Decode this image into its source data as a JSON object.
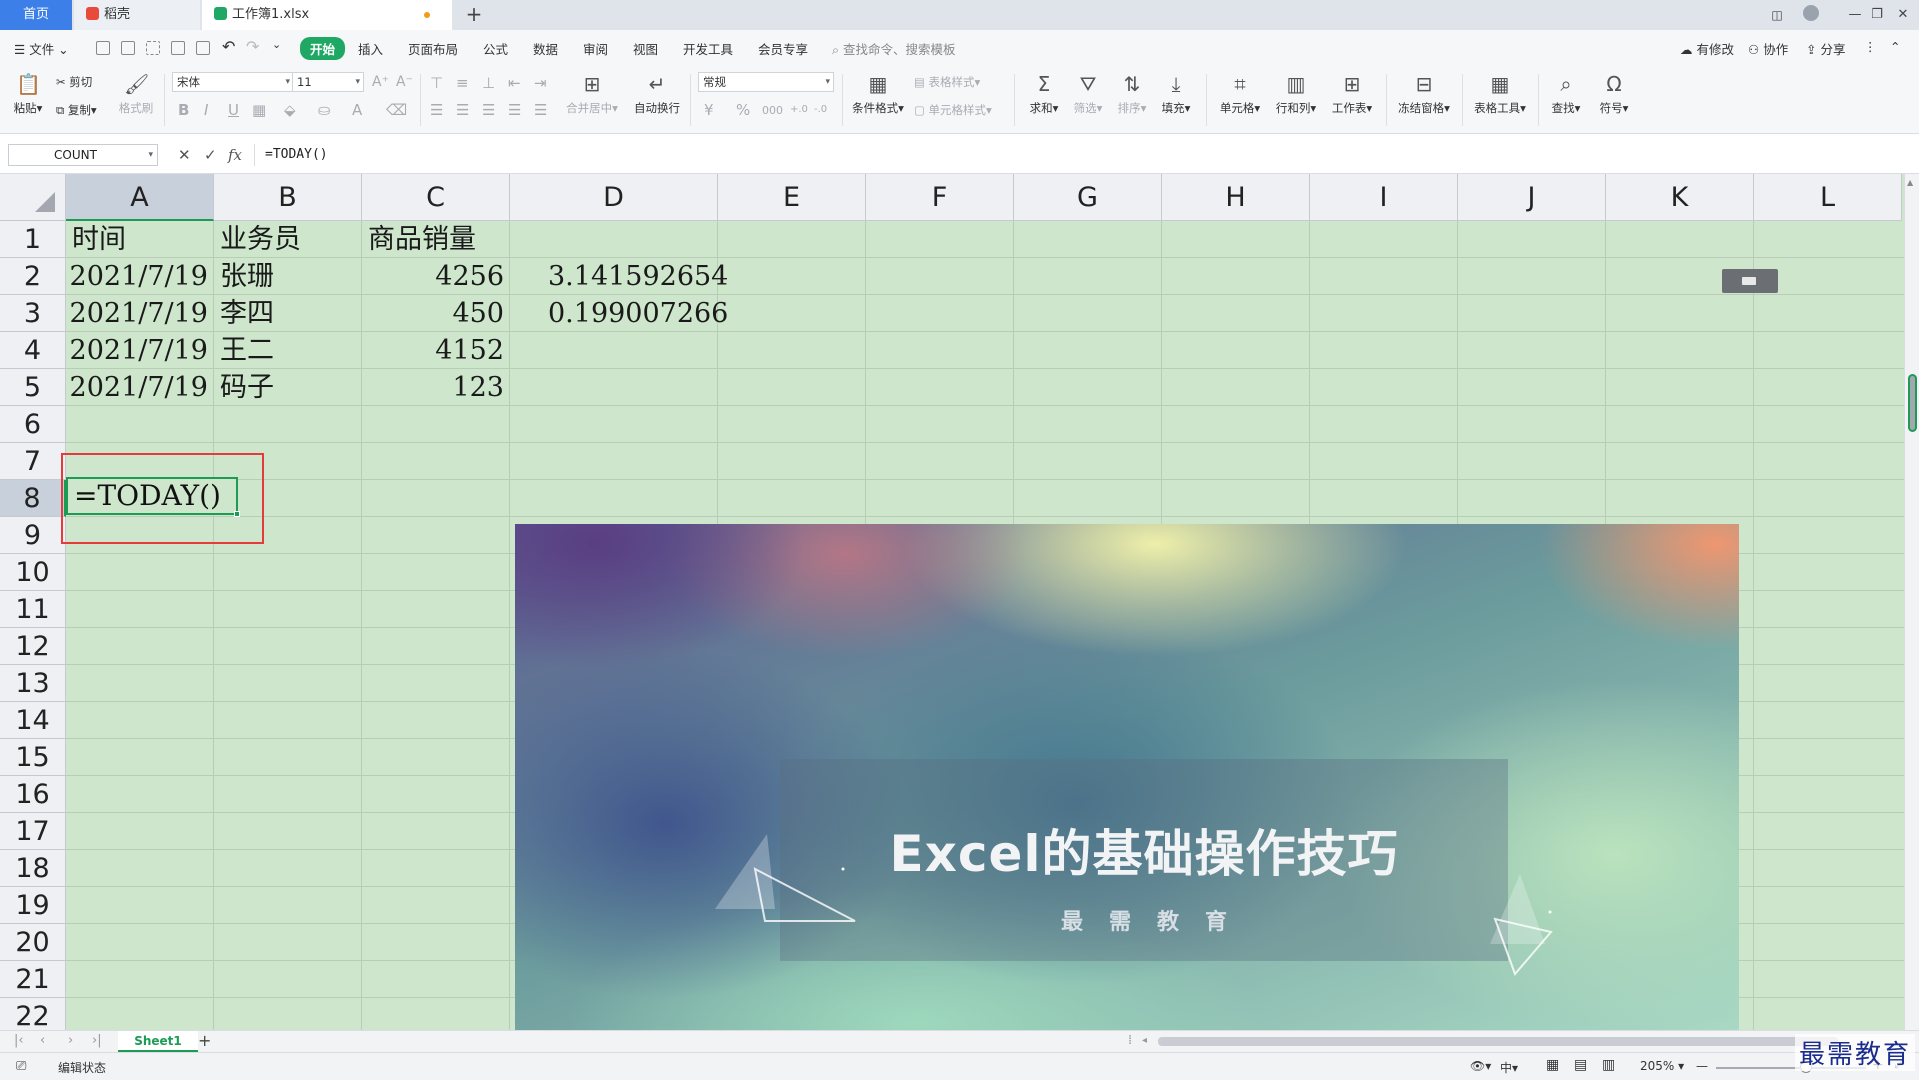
{
  "tabs": {
    "home": "首页",
    "daoke": "稻壳",
    "file": "工作簿1.xlsx",
    "add": "+"
  },
  "window": {
    "minimize": "—",
    "restore": "❐",
    "close": "✕"
  },
  "menu": {
    "file": "文件",
    "items": [
      "开始",
      "插入",
      "页面布局",
      "公式",
      "数据",
      "审阅",
      "视图",
      "开发工具",
      "会员专享"
    ],
    "search_placeholder": "查找命令、搜索模板",
    "actions": [
      "有修改",
      "协作",
      "分享"
    ]
  },
  "toolbar": {
    "paste": "粘贴",
    "cut": "剪切",
    "copy": "复制",
    "format_painter": "格式刷",
    "font_name": "宋体",
    "font_size": "11",
    "merge_center": "合并居中",
    "wrap_text": "自动换行",
    "number_format": "常规",
    "conditional_format": "条件格式",
    "table_style": "表格样式",
    "cell_style": "单元格样式",
    "sum": "求和",
    "filter": "筛选",
    "sort": "排序",
    "fill": "填充",
    "cell": "单元格",
    "row_col": "行和列",
    "worksheet": "工作表",
    "freeze": "冻结窗格",
    "table_tools": "表格工具",
    "find": "查找",
    "symbol": "符号"
  },
  "formula_bar": {
    "name_box": "COUNT",
    "cancel": "✕",
    "confirm": "✓",
    "fx": "fx",
    "content": "=TODAY()"
  },
  "sheet": {
    "columns": [
      "A",
      "B",
      "C",
      "D",
      "E",
      "F",
      "G",
      "H",
      "I",
      "J",
      "K",
      "L"
    ],
    "rows": [
      "1",
      "2",
      "3",
      "4",
      "5",
      "6",
      "7",
      "8",
      "9",
      "10",
      "11",
      "12",
      "13",
      "14",
      "15",
      "16",
      "17",
      "18",
      "19",
      "20",
      "21",
      "22"
    ],
    "cells": {
      "A1": "时间",
      "B1": "业务员",
      "C1": "商品销量",
      "A2": "2021/7/19",
      "B2": "张珊",
      "C2": "4256",
      "D2": "3.141592654",
      "A3": "2021/7/19",
      "B3": "李四",
      "C3": "450",
      "D3": "0.199007266",
      "A4": "2021/7/19",
      "B4": "王二",
      "C4": "4152",
      "A5": "2021/7/19",
      "B5": "码子",
      "C5": "123"
    },
    "editing_cell": "A8",
    "editing_value": "=TODAY()"
  },
  "banner": {
    "title": "Excel的基础操作技巧",
    "subtitle": "最需教育"
  },
  "sheet_tabs": {
    "active": "Sheet1",
    "add": "+"
  },
  "status": {
    "mode": "编辑状态",
    "zoom": "205%",
    "zoom_out": "—",
    "zoom_in": "+"
  },
  "watermark": "最需教育"
}
